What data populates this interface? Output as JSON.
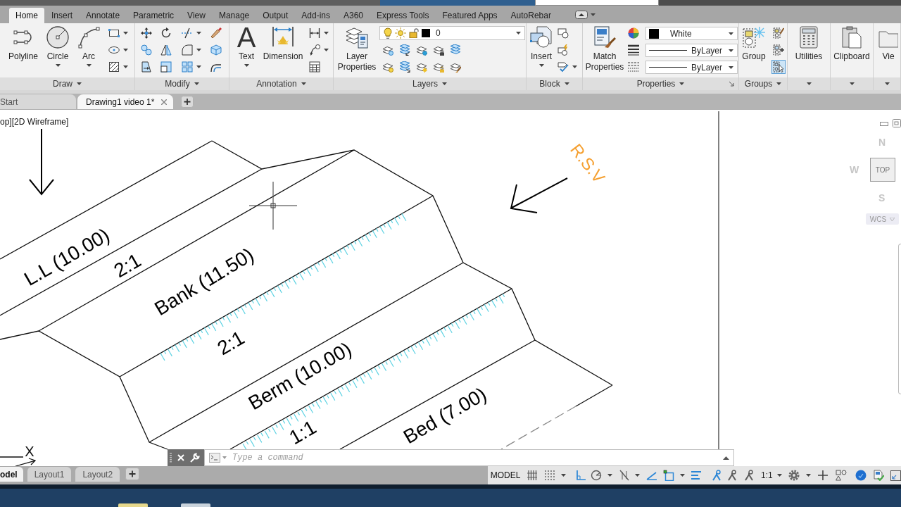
{
  "ribbon_tabs": [
    {
      "label": "Home",
      "selected": true
    },
    {
      "label": "Insert",
      "selected": false
    },
    {
      "label": "Annotate",
      "selected": false
    },
    {
      "label": "Parametric",
      "selected": false
    },
    {
      "label": "View",
      "selected": false
    },
    {
      "label": "Manage",
      "selected": false
    },
    {
      "label": "Output",
      "selected": false
    },
    {
      "label": "Add-ins",
      "selected": false
    },
    {
      "label": "A360",
      "selected": false
    },
    {
      "label": "Express Tools",
      "selected": false
    },
    {
      "label": "Featured Apps",
      "selected": false
    },
    {
      "label": "AutoRebar",
      "selected": false
    }
  ],
  "ribbon_panels": [
    {
      "title": "Draw",
      "buttons": [
        {
          "label": "Polyline",
          "dropdown": false
        },
        {
          "label": "Circle",
          "dropdown": true
        },
        {
          "label": "Arc",
          "dropdown": true
        }
      ]
    },
    {
      "title": "Modify"
    },
    {
      "title": "Annotation",
      "buttons": [
        {
          "label": "Text",
          "glyph": "A",
          "dropdown": true
        },
        {
          "label": "Dimension",
          "dropdown": false
        }
      ]
    },
    {
      "title": "Layers",
      "buttons": [
        {
          "label": "Layer Properties",
          "dropdown": false
        }
      ],
      "layer_dropdown": {
        "value": "0"
      }
    },
    {
      "title": "Block",
      "buttons": [
        {
          "label": "Insert",
          "dropdown": true
        }
      ]
    },
    {
      "title": "Properties",
      "buttons": [
        {
          "label": "Match Properties",
          "dropdown": false
        }
      ],
      "color_dropdown": {
        "value": "White"
      },
      "linetype_dropdown": {
        "value": "ByLayer"
      },
      "lineweight_dropdown": {
        "value": "ByLayer"
      }
    },
    {
      "title": "Groups",
      "buttons": [
        {
          "label": "Group",
          "dropdown": false
        }
      ],
      "selection_toggle": {
        "on": true
      }
    },
    {
      "buttons": [
        {
          "label": "Utilities",
          "dropdown": false
        }
      ]
    },
    {
      "buttons": [
        {
          "label": "Clipboard",
          "dropdown": false
        }
      ]
    },
    {
      "buttons": [
        {
          "label": "Vie",
          "dropdown": false
        }
      ]
    }
  ],
  "file_tabs": [
    {
      "label": "Start",
      "selected": false,
      "closable": false
    },
    {
      "label": "Drawing1 video 1*",
      "selected": true,
      "closable": true
    }
  ],
  "viewport": {
    "label": "op][2D Wireframe]"
  },
  "drawing": {
    "labels": [
      {
        "text": "L.L (10.00)",
        "color": "#000000"
      },
      {
        "text": "2:1",
        "color": "#000000"
      },
      {
        "text": "Bank (11.50)",
        "color": "#000000"
      },
      {
        "text": "2:1",
        "color": "#000000"
      },
      {
        "text": "Berm (10.00)",
        "color": "#000000"
      },
      {
        "text": "1:1",
        "color": "#000000"
      },
      {
        "text": "Bed (7.00)",
        "color": "#000000"
      },
      {
        "text": "R.S.V",
        "color": "#f5a031"
      }
    ],
    "ucs_axis": "X"
  },
  "viewcube": {
    "north": "N",
    "west": "W",
    "face": "TOP",
    "south": "S",
    "coordinate_system": "WCS"
  },
  "command_line": {
    "placeholder": "Type a command"
  },
  "layout_tabs": [
    {
      "label": "odel",
      "selected": true
    },
    {
      "label": "Layout1",
      "selected": false
    },
    {
      "label": "Layout2",
      "selected": false
    }
  ],
  "status_bar": {
    "space": "MODEL",
    "toggles": [
      {
        "on": false
      },
      {
        "on": false
      },
      {
        "on": true
      },
      {
        "on": false
      },
      {
        "on": false
      },
      {
        "on": true
      },
      {
        "on": true
      },
      {
        "on": true
      },
      {
        "on": true
      },
      {
        "on": false
      },
      {
        "on": false
      }
    ],
    "annotation_scale": "1:1"
  }
}
